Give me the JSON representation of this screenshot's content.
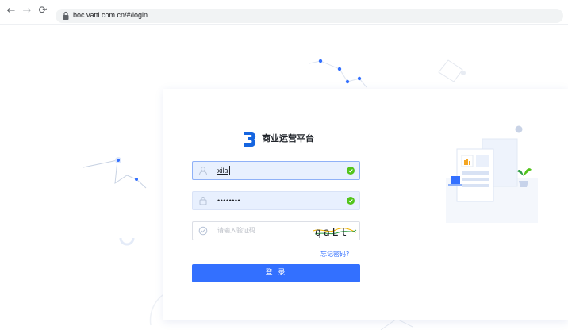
{
  "browser": {
    "url": "boc.vatti.com.cn/#/login"
  },
  "login": {
    "brand_title": "商业运营平台",
    "username_value": "xila",
    "password_value": "••••••••",
    "captcha_placeholder": "请输入验证码",
    "captcha_text": "qaLl",
    "forgot_link": "忘记密码?",
    "submit_label": "登 录"
  },
  "colors": {
    "accent": "#3370ff",
    "success": "#52c41a",
    "input_bg": "#e8f0fe"
  },
  "icons": {
    "back": "arrow-left-icon",
    "forward": "arrow-right-icon",
    "reload": "reload-icon",
    "lock": "lock-icon",
    "user": "user-icon",
    "password": "padlock-icon",
    "captcha": "shield-icon",
    "valid": "check-circle-icon"
  }
}
